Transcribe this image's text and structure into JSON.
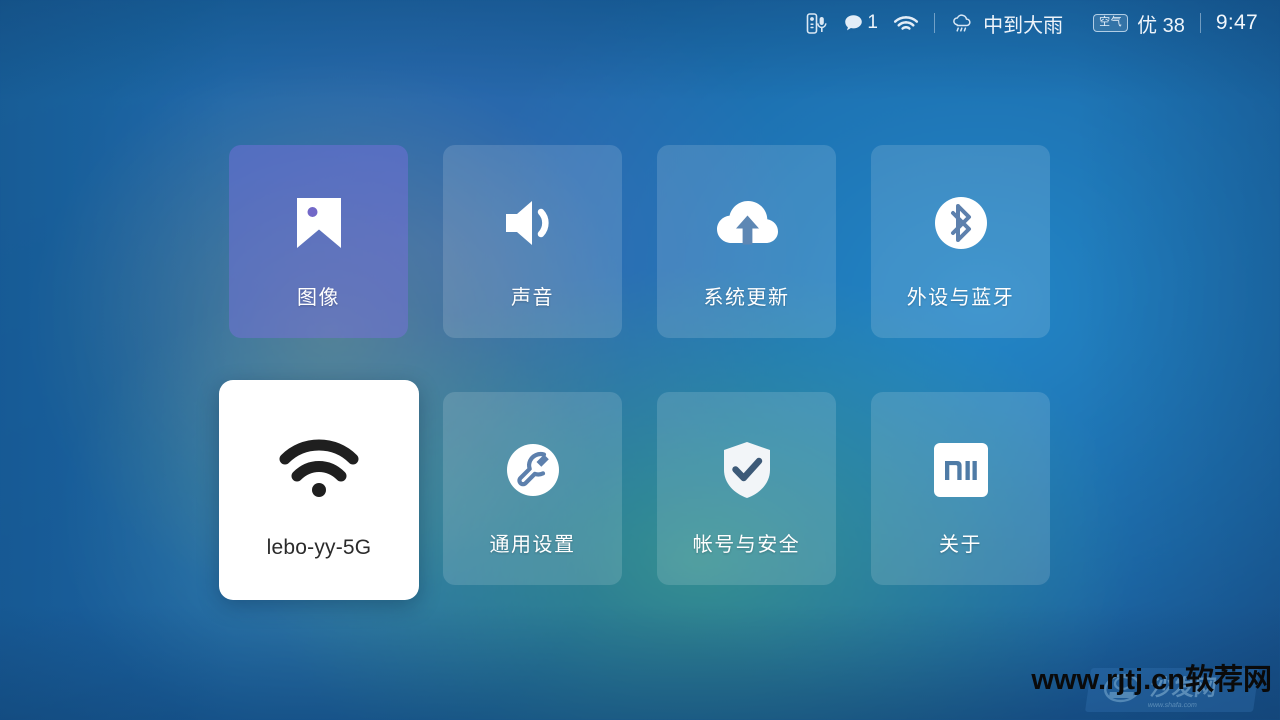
{
  "statusbar": {
    "voice_remote_icon": "voice-remote-icon",
    "message_icon": "message-bubble-icon",
    "message_count": "1",
    "wifi_icon": "wifi-icon",
    "weather_icon": "rain-cloud-icon",
    "weather_text": "中到大雨",
    "air_badge_label": "空气",
    "air_quality": "优 38",
    "clock": "9:47"
  },
  "grid": {
    "tiles": [
      {
        "label": "图像",
        "icon": "image-icon",
        "variant": "violet",
        "selected": false
      },
      {
        "label": "声音",
        "icon": "speaker-icon",
        "variant": "frosted",
        "selected": false
      },
      {
        "label": "系统更新",
        "icon": "cloud-upload-icon",
        "variant": "frosted",
        "selected": false
      },
      {
        "label": "外设与蓝牙",
        "icon": "bluetooth-icon",
        "variant": "frosted",
        "selected": false
      },
      {
        "label": "lebo-yy-5G",
        "icon": "wifi-icon",
        "variant": "selected",
        "selected": true
      },
      {
        "label": "通用设置",
        "icon": "wrench-circle-icon",
        "variant": "frosted",
        "selected": false
      },
      {
        "label": "帐号与安全",
        "icon": "shield-check-icon",
        "variant": "frosted",
        "selected": false
      },
      {
        "label": "关于",
        "icon": "mi-logo-icon",
        "variant": "frosted",
        "selected": false
      }
    ]
  },
  "watermark": {
    "text": "www.rjtj.cn软荐网",
    "logo_text": "沙发网",
    "logo_sub": "www.shafa.com"
  },
  "colors": {
    "background_blue": "#1a64a8",
    "tile_frosted": "rgba(255,255,255,0.14)",
    "tile_violet": "rgba(124,112,224,0.46)",
    "selected_tile": "#ffffff",
    "selected_text": "#2b2b2b",
    "tile_text": "#ffffff",
    "status_text": "#e8f0f8",
    "watermark": "#0a0a0a"
  }
}
